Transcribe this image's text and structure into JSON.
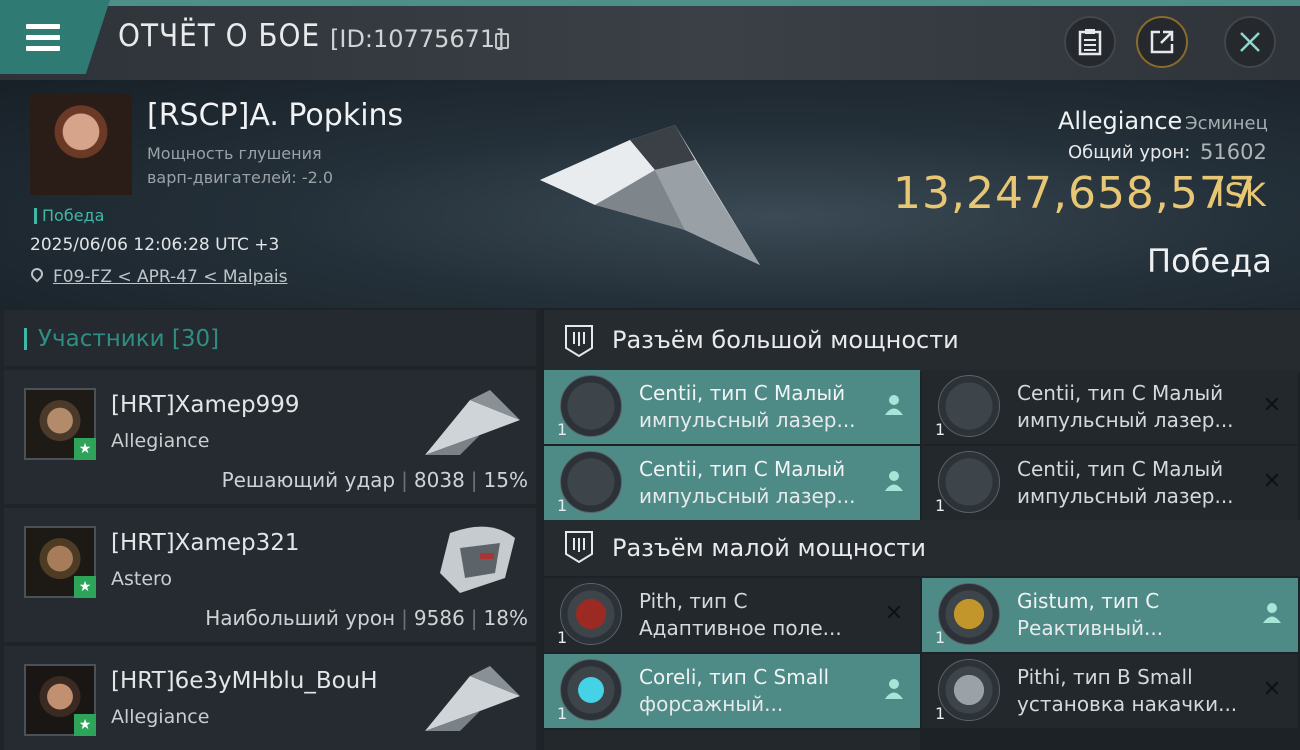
{
  "header": {
    "title": "ОТЧЁТ О БОЕ",
    "report_id": "[ID:10775671]",
    "icons": [
      "menu-icon",
      "copy-icon",
      "clipboard-icon",
      "share-icon",
      "close-icon"
    ]
  },
  "victim": {
    "name": "[RSCP]A. Popkins",
    "jam_line1": "Мощность глушения",
    "jam_line2": "варп-двигателей: -2.0",
    "status_small": "Победа",
    "datetime": "2025/06/06 12:06:28 UTC +3",
    "location": "F09-FZ < APR-47 < Malpais",
    "corp": "Allegiance",
    "ship_type": "Эсминец",
    "damage_label": "Общий урон:",
    "damage_value": "51602",
    "isk_value": "13,247,658,577",
    "isk_unit": "ISK",
    "result": "Победа"
  },
  "participants": {
    "title": "Участники [30]",
    "rows": [
      {
        "name": "[HRT]Xamep999",
        "corp": "Allegiance",
        "role": "Решающий удар",
        "damage": "8038",
        "percent": "15%"
      },
      {
        "name": "[HRT]Xamep321",
        "corp": "Astero",
        "role": "Наибольший урон",
        "damage": "9586",
        "percent": "18%"
      },
      {
        "name": "[HRT]6e3yMHblu_BouH",
        "corp": "Allegiance",
        "role": "",
        "damage": "",
        "percent": ""
      }
    ]
  },
  "fitting": {
    "high_title": "Разъём большой мощности",
    "low_title": "Разъём малой мощности",
    "high": [
      {
        "qty": "1",
        "l1": "Centii, тип C Малый",
        "l2": "импульсный лазер...",
        "state": "on"
      },
      {
        "qty": "1",
        "l1": "Centii, тип C Малый",
        "l2": "импульсный лазер...",
        "state": "off"
      },
      {
        "qty": "1",
        "l1": "Centii, тип C Малый",
        "l2": "импульсный лазер...",
        "state": "on"
      },
      {
        "qty": "1",
        "l1": "Centii, тип C Малый",
        "l2": "импульсный лазер...",
        "state": "off"
      }
    ],
    "low": [
      {
        "qty": "1",
        "l1": "Pith, тип C",
        "l2": "Адаптивное поле...",
        "state": "off"
      },
      {
        "qty": "1",
        "l1": "Gistum, тип C",
        "l2": "Реактивный...",
        "state": "on"
      },
      {
        "qty": "1",
        "l1": "Coreli, тип C Small",
        "l2": "форсажный...",
        "state": "on"
      },
      {
        "qty": "1",
        "l1": "Pithi, тип B Small",
        "l2": "установка накачки...",
        "state": "off"
      }
    ]
  }
}
